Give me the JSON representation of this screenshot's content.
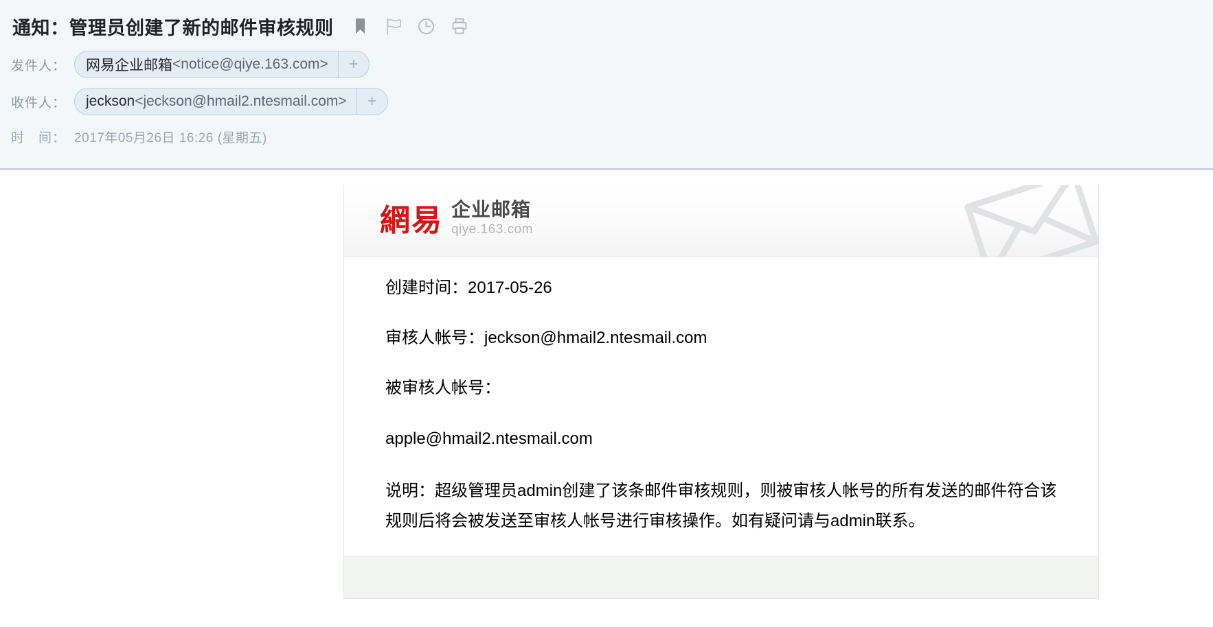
{
  "header": {
    "subject": "通知：管理员创建了新的邮件审核规则",
    "icons": [
      {
        "name": "bookmark-icon",
        "label": "标记"
      },
      {
        "name": "flag-icon",
        "label": "红旗标记"
      },
      {
        "name": "clock-icon",
        "label": "定时"
      },
      {
        "name": "print-icon",
        "label": "打印"
      }
    ],
    "from": {
      "label": "发件人：",
      "name": "网易企业邮箱",
      "address": "<notice@qiye.163.com>",
      "plus": "+"
    },
    "to": {
      "label": "收件人：",
      "name": "jeckson",
      "address": "<jeckson@hmail2.ntesmail.com>",
      "plus": "+"
    },
    "time": {
      "label": "时　间：",
      "value": "2017年05月26日 16:26 (星期五)"
    }
  },
  "card": {
    "brand": {
      "logo_cn": "網易",
      "sub": "企业邮箱",
      "url": "qiye.163.com",
      "watermark": "envelope-watermark"
    },
    "lines": [
      "创建时间：2017-05-26",
      "审核人帐号：jeckson@hmail2.ntesmail.com",
      "被审核人帐号：",
      "apple@hmail2.ntesmail.com"
    ],
    "note": "说明：超级管理员admin创建了该条邮件审核规则，则被审核人帐号的所有发送的邮件符合该规则后将会被发送至审核人帐号进行审核操作。如有疑问请与admin联系。"
  },
  "colors": {
    "brand_red": "#d31616",
    "header_bg": "#f4f7fa",
    "chip_bg": "#e4ecf4",
    "chip_border": "#bfcfdd"
  }
}
